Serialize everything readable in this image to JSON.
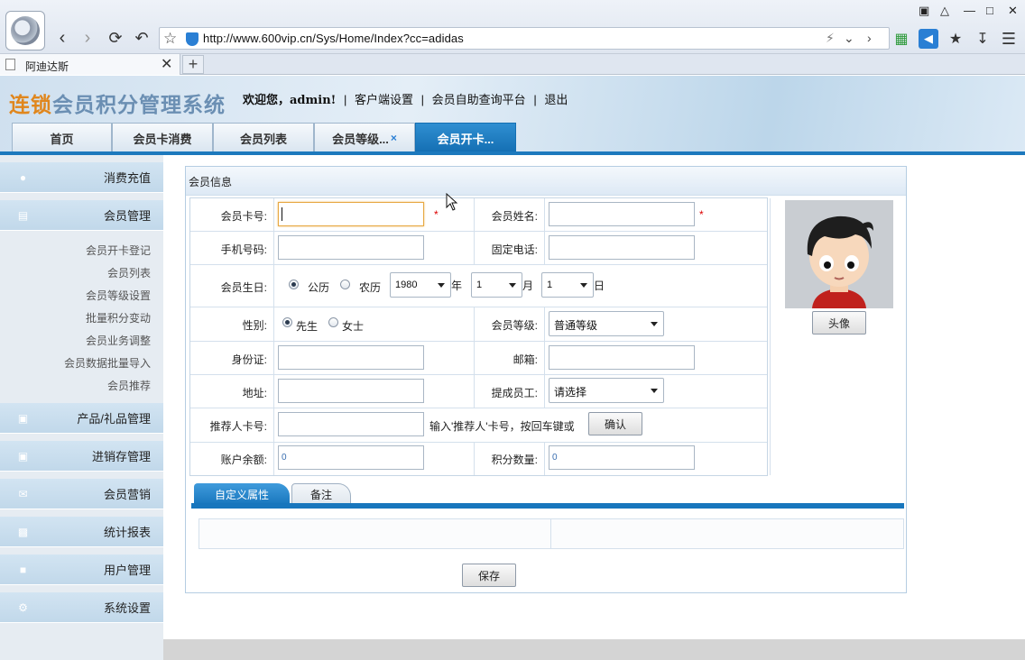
{
  "browser": {
    "url": "http://www.600vip.cn/Sys/Home/Index?cc=adidas",
    "tab_title": "阿迪达斯",
    "tab_close": "✕",
    "new_tab": "+"
  },
  "header": {
    "logo_part1": "连锁",
    "logo_part2": "会员积分管理系统",
    "welcome": "欢迎您，admin!",
    "links": [
      "客户端设置",
      "会员自助查询平台",
      "退出"
    ],
    "separator": "|"
  },
  "nav_tabs": [
    {
      "label": "首页"
    },
    {
      "label": "会员卡消费"
    },
    {
      "label": "会员列表"
    },
    {
      "label": "会员等级...",
      "close": "×"
    },
    {
      "label": "会员开卡..."
    }
  ],
  "sidebar": {
    "groups": [
      {
        "label": "消费充值",
        "icon": "user-icon"
      },
      {
        "label": "会员管理",
        "icon": "id-card-icon"
      },
      {
        "label": "产品/礼品管理",
        "icon": "gift-icon"
      },
      {
        "label": "进销存管理",
        "icon": "gift-icon"
      },
      {
        "label": "会员营销",
        "icon": "mail-icon"
      },
      {
        "label": "统计报表",
        "icon": "monitor-icon"
      },
      {
        "label": "用户管理",
        "icon": "lock-icon"
      },
      {
        "label": "系统设置",
        "icon": "gears-icon"
      }
    ],
    "member_sub_items": [
      "会员开卡登记",
      "会员列表",
      "会员等级设置",
      "批量积分变动",
      "会员业务调整",
      "会员数据批量导入",
      "会员推荐"
    ]
  },
  "panel": {
    "title": "会员信息"
  },
  "form": {
    "card_no_label": "会员卡号:",
    "card_no_value": "",
    "name_label": "会员姓名:",
    "name_value": "",
    "required_mark": "*",
    "mobile_label": "手机号码:",
    "mobile_value": "",
    "phone_label": "固定电话:",
    "phone_value": "",
    "birthday_label": "会员生日:",
    "calendar_options": [
      "公历",
      "农历"
    ],
    "calendar_selected": "公历",
    "birth_year": "1980",
    "year_unit": "年",
    "birth_month": "1",
    "month_unit": "月",
    "birth_day": "1",
    "day_unit": "日",
    "gender_label": "性别:",
    "gender_options": [
      "先生",
      "女士"
    ],
    "gender_selected": "先生",
    "level_label": "会员等级:",
    "level_value": "普通等级",
    "id_label": "身份证:",
    "id_value": "",
    "email_label": "邮箱:",
    "email_value": "",
    "address_label": "地址:",
    "address_value": "",
    "staff_label": "提成员工:",
    "staff_value": "请选择",
    "referrer_label": "推荐人卡号:",
    "referrer_value": "",
    "referrer_hint": "输入'推荐人'卡号，按回车键或",
    "confirm_button": "确认",
    "balance_label": "账户余额:",
    "balance_value": "0",
    "points_label": "积分数量:",
    "points_value": "0",
    "avatar_button": "头像"
  },
  "sub_tabs": [
    "自定义属性",
    "备注"
  ],
  "save_button": "保存"
}
